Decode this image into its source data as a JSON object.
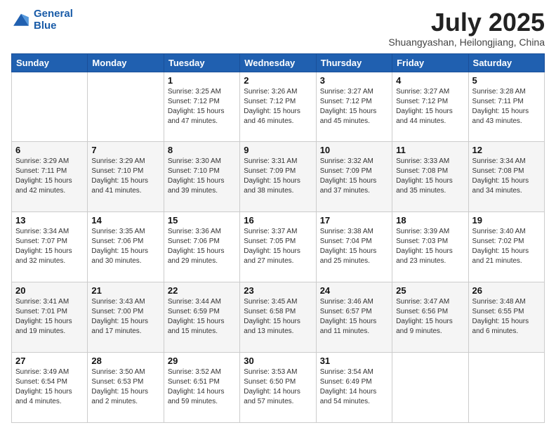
{
  "header": {
    "logo_line1": "General",
    "logo_line2": "Blue",
    "month": "July 2025",
    "location": "Shuangyashan, Heilongjiang, China"
  },
  "days_of_week": [
    "Sunday",
    "Monday",
    "Tuesday",
    "Wednesday",
    "Thursday",
    "Friday",
    "Saturday"
  ],
  "weeks": [
    [
      {
        "day": "",
        "sunrise": "",
        "sunset": "",
        "daylight": ""
      },
      {
        "day": "",
        "sunrise": "",
        "sunset": "",
        "daylight": ""
      },
      {
        "day": "1",
        "sunrise": "Sunrise: 3:25 AM",
        "sunset": "Sunset: 7:12 PM",
        "daylight": "Daylight: 15 hours and 47 minutes."
      },
      {
        "day": "2",
        "sunrise": "Sunrise: 3:26 AM",
        "sunset": "Sunset: 7:12 PM",
        "daylight": "Daylight: 15 hours and 46 minutes."
      },
      {
        "day": "3",
        "sunrise": "Sunrise: 3:27 AM",
        "sunset": "Sunset: 7:12 PM",
        "daylight": "Daylight: 15 hours and 45 minutes."
      },
      {
        "day": "4",
        "sunrise": "Sunrise: 3:27 AM",
        "sunset": "Sunset: 7:12 PM",
        "daylight": "Daylight: 15 hours and 44 minutes."
      },
      {
        "day": "5",
        "sunrise": "Sunrise: 3:28 AM",
        "sunset": "Sunset: 7:11 PM",
        "daylight": "Daylight: 15 hours and 43 minutes."
      }
    ],
    [
      {
        "day": "6",
        "sunrise": "Sunrise: 3:29 AM",
        "sunset": "Sunset: 7:11 PM",
        "daylight": "Daylight: 15 hours and 42 minutes."
      },
      {
        "day": "7",
        "sunrise": "Sunrise: 3:29 AM",
        "sunset": "Sunset: 7:10 PM",
        "daylight": "Daylight: 15 hours and 41 minutes."
      },
      {
        "day": "8",
        "sunrise": "Sunrise: 3:30 AM",
        "sunset": "Sunset: 7:10 PM",
        "daylight": "Daylight: 15 hours and 39 minutes."
      },
      {
        "day": "9",
        "sunrise": "Sunrise: 3:31 AM",
        "sunset": "Sunset: 7:09 PM",
        "daylight": "Daylight: 15 hours and 38 minutes."
      },
      {
        "day": "10",
        "sunrise": "Sunrise: 3:32 AM",
        "sunset": "Sunset: 7:09 PM",
        "daylight": "Daylight: 15 hours and 37 minutes."
      },
      {
        "day": "11",
        "sunrise": "Sunrise: 3:33 AM",
        "sunset": "Sunset: 7:08 PM",
        "daylight": "Daylight: 15 hours and 35 minutes."
      },
      {
        "day": "12",
        "sunrise": "Sunrise: 3:34 AM",
        "sunset": "Sunset: 7:08 PM",
        "daylight": "Daylight: 15 hours and 34 minutes."
      }
    ],
    [
      {
        "day": "13",
        "sunrise": "Sunrise: 3:34 AM",
        "sunset": "Sunset: 7:07 PM",
        "daylight": "Daylight: 15 hours and 32 minutes."
      },
      {
        "day": "14",
        "sunrise": "Sunrise: 3:35 AM",
        "sunset": "Sunset: 7:06 PM",
        "daylight": "Daylight: 15 hours and 30 minutes."
      },
      {
        "day": "15",
        "sunrise": "Sunrise: 3:36 AM",
        "sunset": "Sunset: 7:06 PM",
        "daylight": "Daylight: 15 hours and 29 minutes."
      },
      {
        "day": "16",
        "sunrise": "Sunrise: 3:37 AM",
        "sunset": "Sunset: 7:05 PM",
        "daylight": "Daylight: 15 hours and 27 minutes."
      },
      {
        "day": "17",
        "sunrise": "Sunrise: 3:38 AM",
        "sunset": "Sunset: 7:04 PM",
        "daylight": "Daylight: 15 hours and 25 minutes."
      },
      {
        "day": "18",
        "sunrise": "Sunrise: 3:39 AM",
        "sunset": "Sunset: 7:03 PM",
        "daylight": "Daylight: 15 hours and 23 minutes."
      },
      {
        "day": "19",
        "sunrise": "Sunrise: 3:40 AM",
        "sunset": "Sunset: 7:02 PM",
        "daylight": "Daylight: 15 hours and 21 minutes."
      }
    ],
    [
      {
        "day": "20",
        "sunrise": "Sunrise: 3:41 AM",
        "sunset": "Sunset: 7:01 PM",
        "daylight": "Daylight: 15 hours and 19 minutes."
      },
      {
        "day": "21",
        "sunrise": "Sunrise: 3:43 AM",
        "sunset": "Sunset: 7:00 PM",
        "daylight": "Daylight: 15 hours and 17 minutes."
      },
      {
        "day": "22",
        "sunrise": "Sunrise: 3:44 AM",
        "sunset": "Sunset: 6:59 PM",
        "daylight": "Daylight: 15 hours and 15 minutes."
      },
      {
        "day": "23",
        "sunrise": "Sunrise: 3:45 AM",
        "sunset": "Sunset: 6:58 PM",
        "daylight": "Daylight: 15 hours and 13 minutes."
      },
      {
        "day": "24",
        "sunrise": "Sunrise: 3:46 AM",
        "sunset": "Sunset: 6:57 PM",
        "daylight": "Daylight: 15 hours and 11 minutes."
      },
      {
        "day": "25",
        "sunrise": "Sunrise: 3:47 AM",
        "sunset": "Sunset: 6:56 PM",
        "daylight": "Daylight: 15 hours and 9 minutes."
      },
      {
        "day": "26",
        "sunrise": "Sunrise: 3:48 AM",
        "sunset": "Sunset: 6:55 PM",
        "daylight": "Daylight: 15 hours and 6 minutes."
      }
    ],
    [
      {
        "day": "27",
        "sunrise": "Sunrise: 3:49 AM",
        "sunset": "Sunset: 6:54 PM",
        "daylight": "Daylight: 15 hours and 4 minutes."
      },
      {
        "day": "28",
        "sunrise": "Sunrise: 3:50 AM",
        "sunset": "Sunset: 6:53 PM",
        "daylight": "Daylight: 15 hours and 2 minutes."
      },
      {
        "day": "29",
        "sunrise": "Sunrise: 3:52 AM",
        "sunset": "Sunset: 6:51 PM",
        "daylight": "Daylight: 14 hours and 59 minutes."
      },
      {
        "day": "30",
        "sunrise": "Sunrise: 3:53 AM",
        "sunset": "Sunset: 6:50 PM",
        "daylight": "Daylight: 14 hours and 57 minutes."
      },
      {
        "day": "31",
        "sunrise": "Sunrise: 3:54 AM",
        "sunset": "Sunset: 6:49 PM",
        "daylight": "Daylight: 14 hours and 54 minutes."
      },
      {
        "day": "",
        "sunrise": "",
        "sunset": "",
        "daylight": ""
      },
      {
        "day": "",
        "sunrise": "",
        "sunset": "",
        "daylight": ""
      }
    ]
  ]
}
